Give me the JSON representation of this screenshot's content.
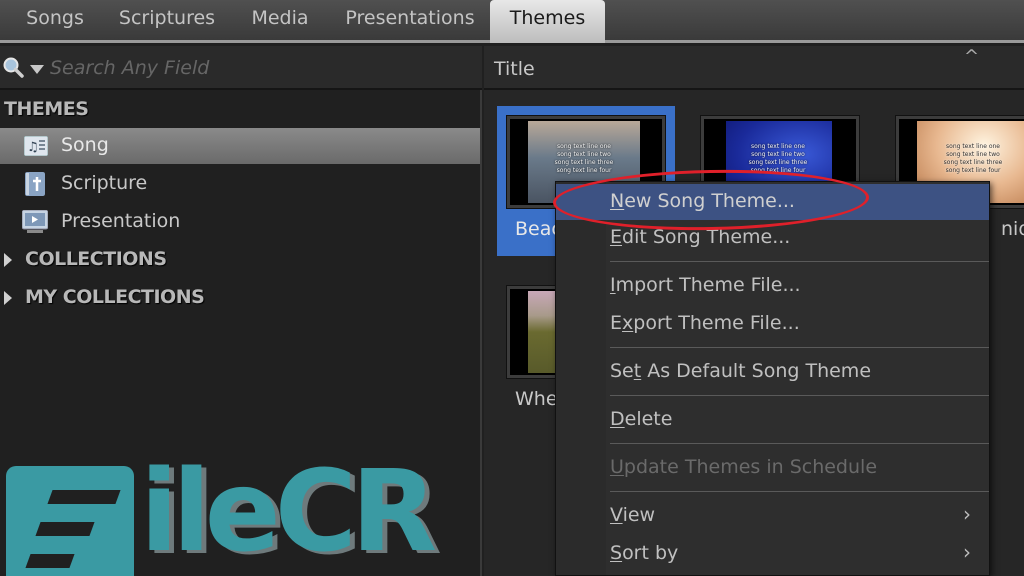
{
  "tabs": [
    {
      "label": "Songs",
      "active": false
    },
    {
      "label": "Scriptures",
      "active": false
    },
    {
      "label": "Media",
      "active": false
    },
    {
      "label": "Presentations",
      "active": false
    },
    {
      "label": "Themes",
      "active": true
    }
  ],
  "search": {
    "placeholder": "Search Any Field",
    "value": "",
    "icon": "search-icon"
  },
  "sidebar": {
    "themes_header": "THEMES",
    "items": [
      {
        "label": "Song",
        "icon": "song-theme-icon",
        "selected": true
      },
      {
        "label": "Scripture",
        "icon": "scripture-theme-icon",
        "selected": false
      },
      {
        "label": "Presentation",
        "icon": "presentation-theme-icon",
        "selected": false
      }
    ],
    "collections": [
      {
        "label": "COLLECTIONS",
        "expanded": false
      },
      {
        "label": "MY COLLECTIONS",
        "expanded": false
      }
    ]
  },
  "list": {
    "column_title": "Title",
    "sort_indicator": "^",
    "thumbnail_text": [
      "song text line one",
      "song text line two",
      "song text line three",
      "song text line four"
    ],
    "themes": [
      {
        "label": "Beac",
        "background": "beach-sunset",
        "selected": true
      },
      {
        "label": "",
        "background": "blue-abstract",
        "selected": false
      },
      {
        "label": "nior",
        "background": "warm-light",
        "selected": false
      },
      {
        "label": "Whe",
        "background": "wheat-field",
        "selected": false
      }
    ]
  },
  "context_menu": {
    "items": [
      {
        "label": "New Song Theme...",
        "mnemonic": "N",
        "hover": true,
        "disabled": false,
        "submenu": false
      },
      {
        "label": "Edit Song Theme...",
        "mnemonic": "E",
        "hover": false,
        "disabled": false,
        "submenu": false
      },
      {
        "label": "Import Theme File...",
        "mnemonic": "I",
        "hover": false,
        "disabled": false,
        "submenu": false
      },
      {
        "label": "Export Theme File...",
        "mnemonic": "x",
        "hover": false,
        "disabled": false,
        "submenu": false
      },
      {
        "label": "Set As Default Song Theme",
        "mnemonic": "t",
        "hover": false,
        "disabled": false,
        "submenu": false
      },
      {
        "label": "Delete",
        "mnemonic": "D",
        "hover": false,
        "disabled": false,
        "submenu": false
      },
      {
        "label": "Update Themes in Schedule",
        "mnemonic": "U",
        "hover": false,
        "disabled": true,
        "submenu": false
      },
      {
        "label": "View",
        "mnemonic": "V",
        "hover": false,
        "disabled": false,
        "submenu": true
      },
      {
        "label": "Sort by",
        "mnemonic": "S",
        "hover": false,
        "disabled": false,
        "submenu": true
      }
    ],
    "submenu_arrow": "›"
  },
  "watermark": {
    "text": "ileCR",
    "color": "#3a9aa3"
  },
  "colors": {
    "selection_blue": "#3a70c8",
    "menu_hover": "#3d5283",
    "annotation_red": "#e0202a"
  }
}
